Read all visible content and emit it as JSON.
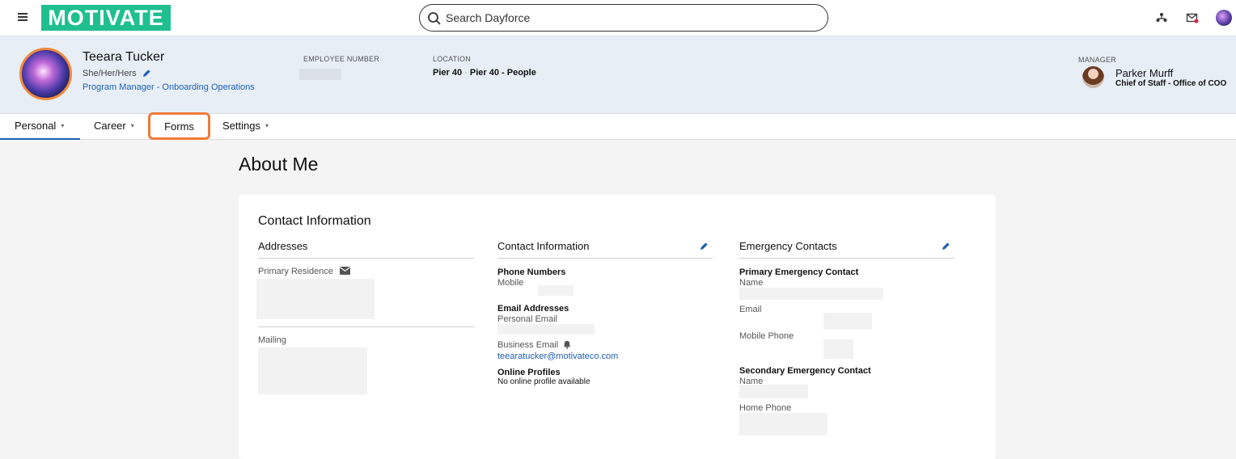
{
  "brand": {
    "logo_text": "MOTIVATE",
    "logo_color": "#1fbf8f",
    "accent": "#1d5fb5",
    "highlight": "#f07a3c"
  },
  "header": {
    "menu_icon": "hamburger-icon",
    "search_placeholder": "Search Dayforce",
    "icons": [
      "org-chart-icon",
      "mail-notification-icon",
      "user-avatar"
    ]
  },
  "profile": {
    "name": "Teeara Tucker",
    "pronouns": "She/Her/Hers",
    "job_title": "Program Manager - Onboarding Operations",
    "employee_number_label": "EMPLOYEE NUMBER",
    "location_label": "LOCATION",
    "location_primary": "Pier 40",
    "location_separator": "·",
    "location_secondary": "Pier 40 - People",
    "manager_label": "MANAGER",
    "manager_name": "Parker Murff",
    "manager_title": "Chief of Staff - Office of COO"
  },
  "tabs": [
    {
      "label": "Personal",
      "has_caret": true,
      "active": true
    },
    {
      "label": "Career",
      "has_caret": true
    },
    {
      "label": "Forms",
      "has_caret": false,
      "highlighted": true
    },
    {
      "label": "Settings",
      "has_caret": true
    }
  ],
  "caret": "▾",
  "page": {
    "title": "About Me",
    "section_title": "Contact Information",
    "addresses": {
      "heading": "Addresses",
      "primary_label": "Primary Residence",
      "mailing_label": "Mailing"
    },
    "contact": {
      "heading": "Contact Information",
      "phone_heading": "Phone Numbers",
      "mobile_label": "Mobile",
      "email_heading": "Email Addresses",
      "personal_email_label": "Personal Email",
      "business_email_label": "Business Email",
      "business_email": "teearatucker@motivateco.com",
      "online_heading": "Online Profiles",
      "online_value": "No online profile available"
    },
    "emergency": {
      "heading": "Emergency Contacts",
      "primary_heading": "Primary Emergency Contact",
      "name_label": "Name",
      "email_label": "Email",
      "mobile_label": "Mobile Phone",
      "secondary_heading": "Secondary Emergency Contact",
      "secondary_name_label": "Name",
      "home_label": "Home Phone"
    }
  }
}
